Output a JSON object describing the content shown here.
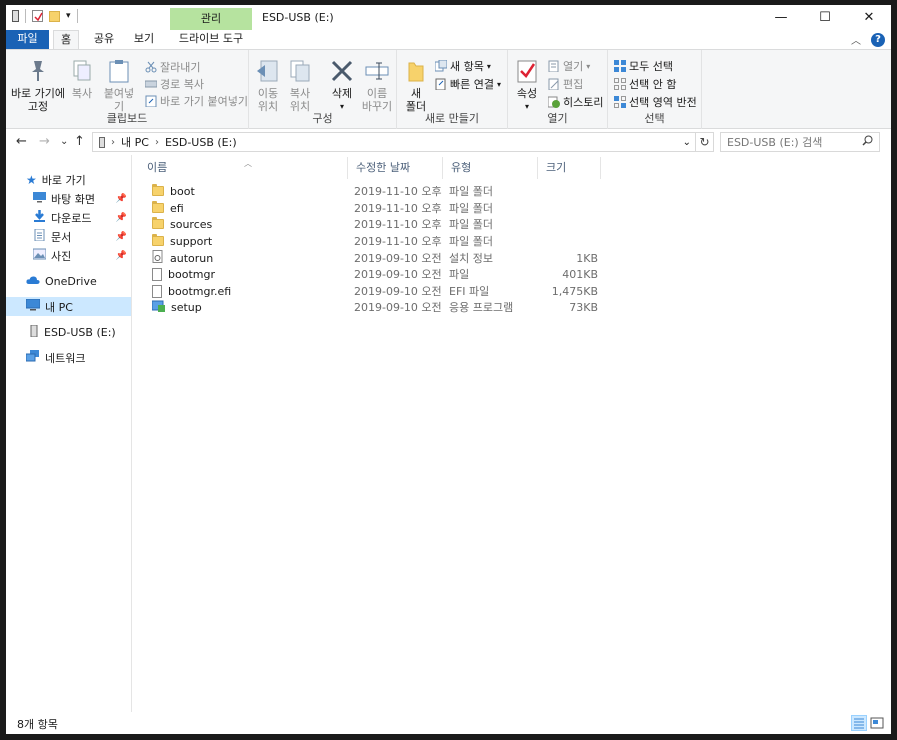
{
  "window": {
    "title": "ESD-USB (E:)",
    "context_tab": "관리",
    "buttons": {
      "minimize": "—",
      "maximize": "☐",
      "close": "✕"
    }
  },
  "ribbon_tabs": {
    "file": "파일",
    "home": "홈",
    "share": "공유",
    "view": "보기",
    "drive_tools": "드라이브 도구",
    "collapse": "︿",
    "help": "?"
  },
  "ribbon": {
    "clipboard": {
      "label": "클립보드",
      "pin_quick_access": "바로 가기에\n고정",
      "copy": "복사",
      "paste": "붙여넣기",
      "cut": "잘라내기",
      "copy_path": "경로 복사",
      "paste_shortcut": "바로 가기 붙여넣기"
    },
    "organize": {
      "label": "구성",
      "move_to": "이동\n위치",
      "copy_to": "복사\n위치",
      "delete": "삭제",
      "rename": "이름\n바꾸기"
    },
    "new": {
      "label": "새로 만들기",
      "new_folder": "새\n폴더",
      "new_item": "새 항목",
      "easy_access": "빠른 연결"
    },
    "open": {
      "label": "열기",
      "properties": "속성",
      "open": "열기",
      "edit": "편집",
      "history": "히스토리"
    },
    "select": {
      "label": "선택",
      "select_all": "모두 선택",
      "select_none": "선택 안 함",
      "invert": "선택 영역 반전"
    }
  },
  "address": {
    "back": "←",
    "forward": "→",
    "recent": "⌄",
    "up": "↑",
    "crumbs": [
      "내 PC",
      "ESD-USB (E:)"
    ],
    "search_placeholder": "ESD-USB (E:) 검색"
  },
  "nav": {
    "quick_access": "바로 가기",
    "items": [
      {
        "label": "바탕 화면",
        "icon": "desktop-icon",
        "pinned": true
      },
      {
        "label": "다운로드",
        "icon": "download-icon",
        "pinned": true
      },
      {
        "label": "문서",
        "icon": "documents-icon",
        "pinned": true
      },
      {
        "label": "사진",
        "icon": "pictures-icon",
        "pinned": true
      }
    ],
    "onedrive": "OneDrive",
    "this_pc": "내 PC",
    "usb": "ESD-USB (E:)",
    "network": "네트워크"
  },
  "columns": {
    "name": "이름",
    "date": "수정한 날짜",
    "type": "유형",
    "size": "크기"
  },
  "files": [
    {
      "name": "boot",
      "date": "2019-11-10 오후 ...",
      "type": "파일 폴더",
      "size": "",
      "kind": "folder"
    },
    {
      "name": "efi",
      "date": "2019-11-10 오후 ...",
      "type": "파일 폴더",
      "size": "",
      "kind": "folder"
    },
    {
      "name": "sources",
      "date": "2019-11-10 오후 ...",
      "type": "파일 폴더",
      "size": "",
      "kind": "folder"
    },
    {
      "name": "support",
      "date": "2019-11-10 오후 ...",
      "type": "파일 폴더",
      "size": "",
      "kind": "folder"
    },
    {
      "name": "autorun",
      "date": "2019-09-10 오전 ...",
      "type": "설치 정보",
      "size": "1KB",
      "kind": "inf"
    },
    {
      "name": "bootmgr",
      "date": "2019-09-10 오전 ...",
      "type": "파일",
      "size": "401KB",
      "kind": "file"
    },
    {
      "name": "bootmgr.efi",
      "date": "2019-09-10 오전 ...",
      "type": "EFI 파일",
      "size": "1,475KB",
      "kind": "file"
    },
    {
      "name": "setup",
      "date": "2019-09-10 오전 ...",
      "type": "응용 프로그램",
      "size": "73KB",
      "kind": "exe"
    }
  ],
  "status": {
    "count": "8개 항목"
  },
  "colors": {
    "accent": "#1a62b5",
    "context_tab": "#b6e39f",
    "selection": "#cce8ff",
    "folder": "#f7d26b"
  }
}
